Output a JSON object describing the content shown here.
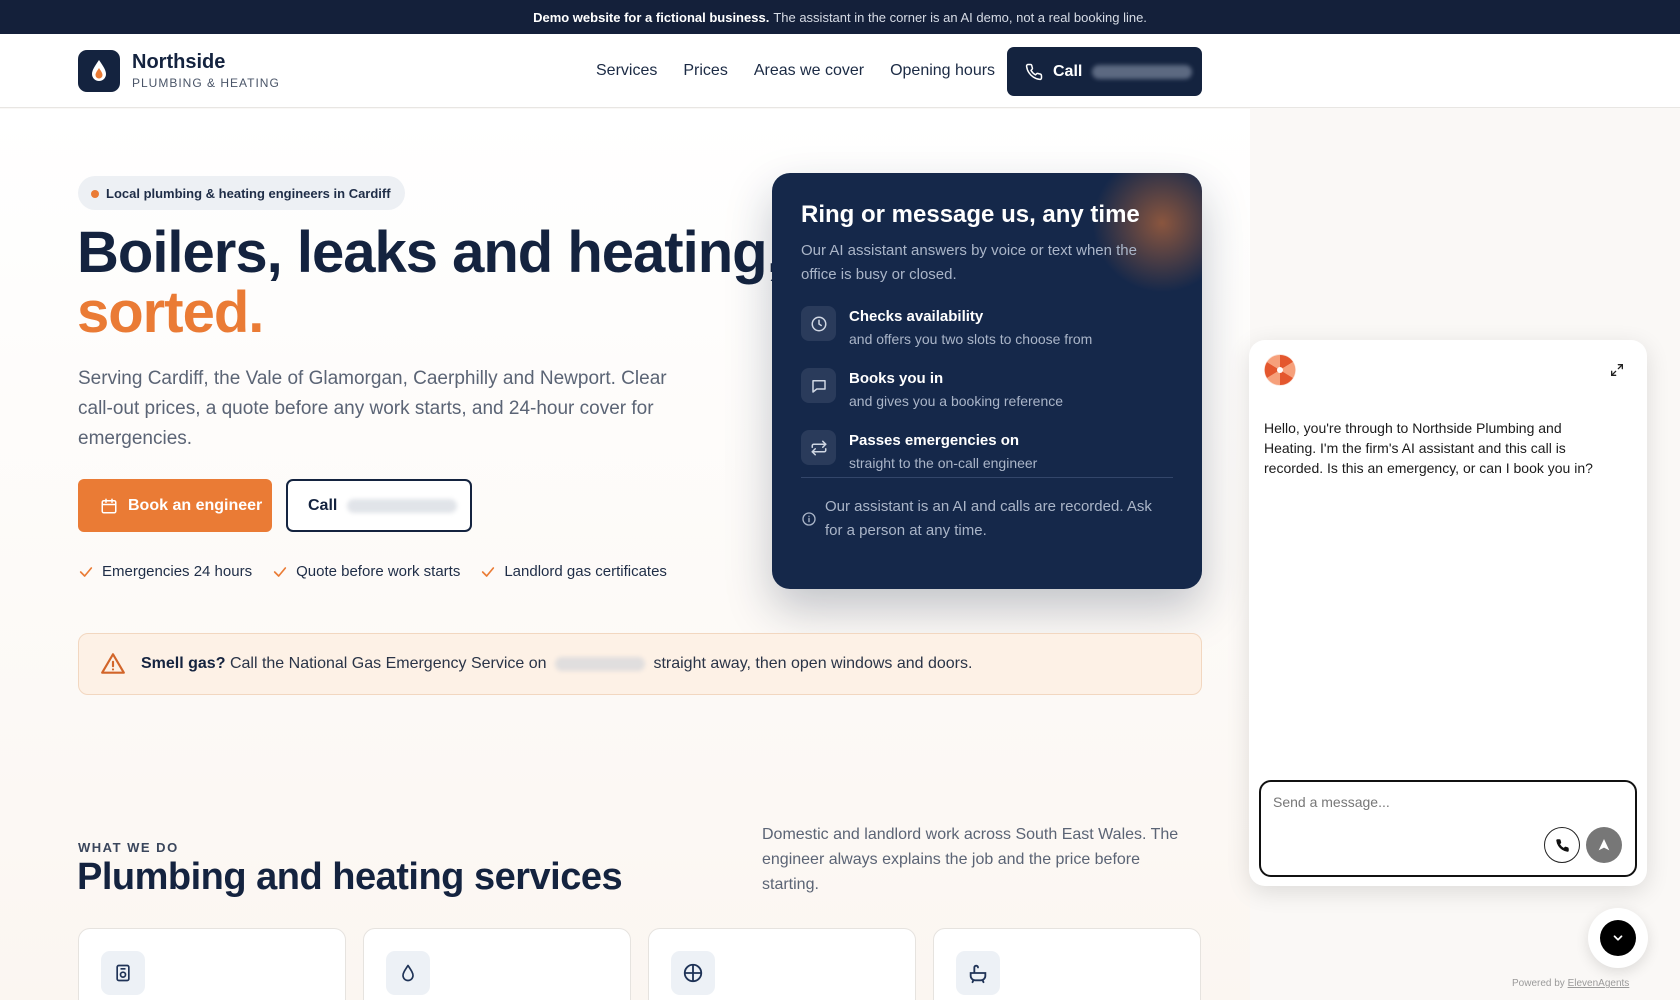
{
  "topbar": {
    "strong": "Demo website for a fictional business.",
    "text": "The assistant in the corner is an AI demo, not a real booking line."
  },
  "brand": {
    "name": "Northside",
    "sub": "PLUMBING & HEATING"
  },
  "nav": {
    "items": [
      "Services",
      "Prices",
      "Areas we cover",
      "Opening hours"
    ],
    "call_label": "Call"
  },
  "hero": {
    "pill": "Local plumbing & heating engineers in Cardiff",
    "title_line1": "Boilers, leaks and heating,",
    "title_line2": "sorted.",
    "lead": "Serving Cardiff, the Vale of Glamorgan, Caerphilly and Newport. Clear call-out prices, a quote before any work starts, and 24-hour cover for emergencies.",
    "book_label": "Book an engineer",
    "call_label": "Call",
    "ticks": [
      "Emergencies 24 hours",
      "Quote before work starts",
      "Landlord gas certificates"
    ]
  },
  "assistant_card": {
    "title": "Ring or message us, any time",
    "subtitle": "Our AI assistant answers by voice or text when the office is busy or closed.",
    "features": [
      {
        "title": "Checks availability",
        "sub": "and offers you two slots to choose from"
      },
      {
        "title": "Books you in",
        "sub": "and gives you a booking reference"
      },
      {
        "title": "Passes emergencies on",
        "sub": "straight to the on-call engineer"
      }
    ],
    "note": "Our assistant is an AI and calls are recorded. Ask for a person at any time."
  },
  "gas_notice": {
    "strong": "Smell gas?",
    "text_before": "Call the National Gas Emergency Service on",
    "text_after": "straight away, then open windows and doors."
  },
  "services": {
    "kicker": "WHAT WE DO",
    "title": "Plumbing and heating services",
    "description": "Domestic and landlord work across South East Wales. The engineer always explains the job and the price before starting."
  },
  "chat": {
    "message": "Hello, you're through to Northside Plumbing and Heating. I'm the firm's AI assistant and this call is recorded. Is this an emergency, or can I book you in?",
    "placeholder": "Send a message...",
    "powered_prefix": "Powered by",
    "powered_link": "ElevenAgents"
  },
  "colors": {
    "navy": "#14233f",
    "accent": "#ea7b35"
  }
}
